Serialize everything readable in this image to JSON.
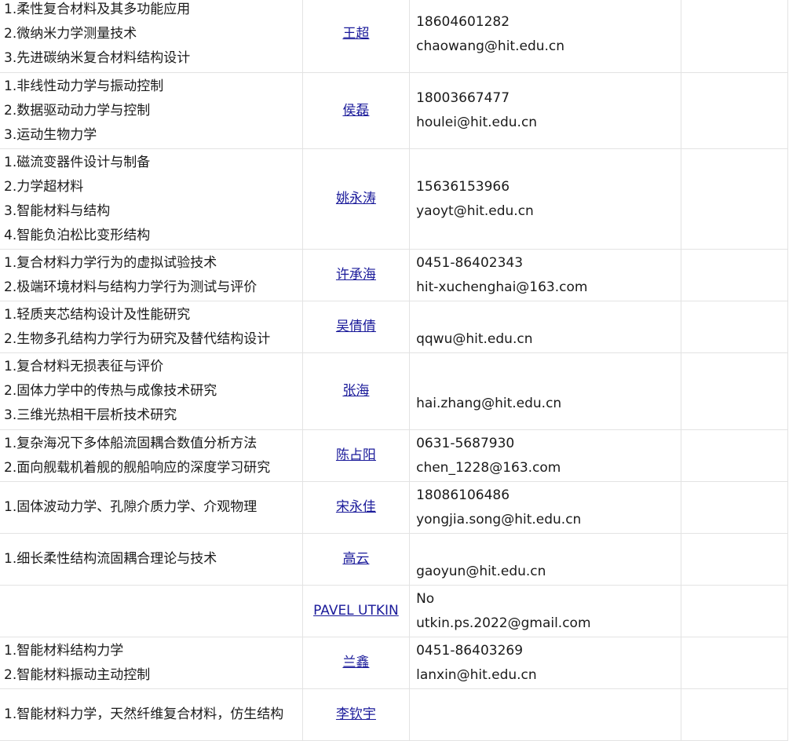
{
  "rows": [
    {
      "areas": [
        "1.柔性复合材料及其多功能应用",
        "2.微纳米力学测量技术",
        "3.先进碳纳米复合材料结构设计"
      ],
      "name": "王超",
      "phone": "18604601282",
      "email": "chaowang@hit.edu.cn"
    },
    {
      "areas": [
        "1.非线性动力学与振动控制",
        "2.数据驱动动力学与控制",
        "3.运动生物力学"
      ],
      "name": "侯磊",
      "phone": "18003667477",
      "email": "houlei@hit.edu.cn"
    },
    {
      "areas": [
        "1.磁流变器件设计与制备",
        "2.力学超材料",
        "3.智能材料与结构",
        "4.智能负泊松比变形结构"
      ],
      "name": "姚永涛",
      "phone": "15636153966",
      "email": "yaoyt@hit.edu.cn"
    },
    {
      "areas": [
        "1.复合材料力学行为的虚拟试验技术",
        "2.极端环境材料与结构力学行为测试与评价"
      ],
      "name": "许承海",
      "phone": "0451-86402343",
      "email": "hit-xuchenghai@163.com"
    },
    {
      "areas": [
        "1.轻质夹芯结构设计及性能研究",
        "2.生物多孔结构力学行为研究及替代结构设计"
      ],
      "name": "吴倩倩",
      "phone": "",
      "email": "qqwu@hit.edu.cn"
    },
    {
      "areas": [
        "1.复合材料无损表征与评价",
        "2.固体力学中的传热与成像技术研究",
        "3.三维光热相干层析技术研究"
      ],
      "name": "张海",
      "phone": "",
      "email": "hai.zhang@hit.edu.cn"
    },
    {
      "areas": [
        "1.复杂海况下多体船流固耦合数值分析方法",
        "2.面向舰载机着舰的舰船响应的深度学习研究"
      ],
      "name": "陈占阳",
      "phone": "0631-5687930",
      "email": "chen_1228@163.com"
    },
    {
      "areas": [
        "1.固体波动力学、孔隙介质力学、介观物理"
      ],
      "name": "宋永佳",
      "phone": "18086106486",
      "email": "yongjia.song@hit.edu.cn"
    },
    {
      "areas": [
        "1.细长柔性结构流固耦合理论与技术"
      ],
      "name": "高云",
      "phone": "",
      "email": "gaoyun@hit.edu.cn"
    },
    {
      "areas": [],
      "name": "PAVEL UTKIN",
      "phone": "No",
      "email": "utkin.ps.2022@gmail.com"
    },
    {
      "areas": [
        "1.智能材料结构力学",
        "2.智能材料振动主动控制"
      ],
      "name": "兰鑫",
      "phone": "0451-86403269",
      "email": "lanxin@hit.edu.cn"
    },
    {
      "areas": [
        "1.智能材料力学，天然纤维复合材料，仿生结构"
      ],
      "name": "李钦宇",
      "phone": "",
      "email": ""
    }
  ]
}
